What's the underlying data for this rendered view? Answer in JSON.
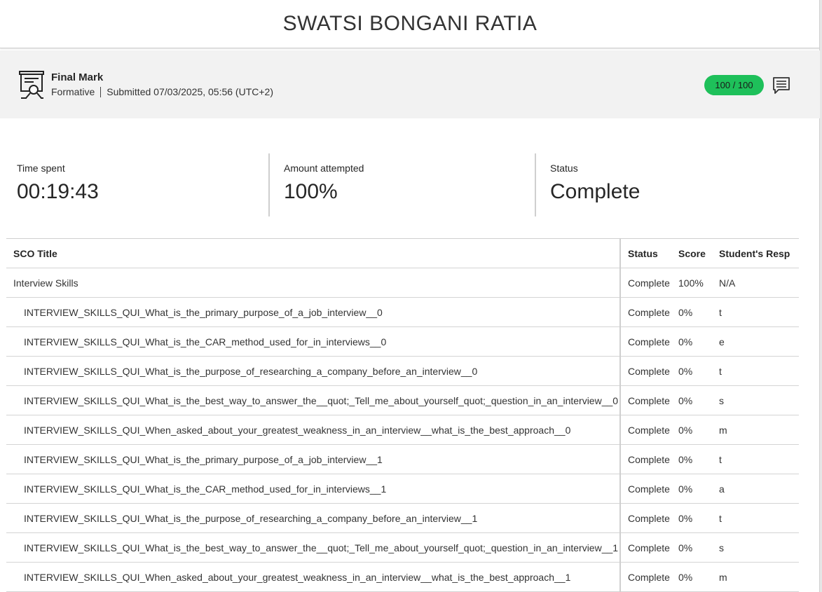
{
  "header": {
    "title": "SWATSI BONGANI RATIA"
  },
  "grade": {
    "title": "Final Mark",
    "type": "Formative",
    "submitted": "Submitted 07/03/2025, 05:56 (UTC+2)",
    "score": "100 / 100",
    "score_color": "#1ec05a",
    "icon": "certificate-icon",
    "feedback_icon": "feedback-comment-icon"
  },
  "stats": {
    "time_label": "Time spent",
    "time_value": "00:19:43",
    "attempted_label": "Amount attempted",
    "attempted_value": "100%",
    "status_label": "Status",
    "status_value": "Complete"
  },
  "table": {
    "headers": {
      "title": "SCO Title",
      "status": "Status",
      "score": "Score",
      "response": "Student's Resp"
    },
    "rows": [
      {
        "title": "Interview Skills",
        "status": "Complete",
        "score": "100%",
        "response": "N/A",
        "indent": false
      },
      {
        "title": "INTERVIEW_SKILLS_QUI_What_is_the_primary_purpose_of_a_job_interview__0",
        "status": "Complete",
        "score": "0%",
        "response": "t",
        "indent": true
      },
      {
        "title": "INTERVIEW_SKILLS_QUI_What_is_the_CAR_method_used_for_in_interviews__0",
        "status": "Complete",
        "score": "0%",
        "response": "e",
        "indent": true
      },
      {
        "title": "INTERVIEW_SKILLS_QUI_What_is_the_purpose_of_researching_a_company_before_an_interview__0",
        "status": "Complete",
        "score": "0%",
        "response": "t",
        "indent": true
      },
      {
        "title": "INTERVIEW_SKILLS_QUI_What_is_the_best_way_to_answer_the__quot;_Tell_me_about_yourself_quot;_question_in_an_interview__0",
        "status": "Complete",
        "score": "0%",
        "response": "s",
        "indent": true
      },
      {
        "title": "INTERVIEW_SKILLS_QUI_When_asked_about_your_greatest_weakness_in_an_interview__what_is_the_best_approach__0",
        "status": "Complete",
        "score": "0%",
        "response": "m",
        "indent": true
      },
      {
        "title": "INTERVIEW_SKILLS_QUI_What_is_the_primary_purpose_of_a_job_interview__1",
        "status": "Complete",
        "score": "0%",
        "response": "t",
        "indent": true
      },
      {
        "title": "INTERVIEW_SKILLS_QUI_What_is_the_CAR_method_used_for_in_interviews__1",
        "status": "Complete",
        "score": "0%",
        "response": "a",
        "indent": true
      },
      {
        "title": "INTERVIEW_SKILLS_QUI_What_is_the_purpose_of_researching_a_company_before_an_interview__1",
        "status": "Complete",
        "score": "0%",
        "response": "t",
        "indent": true
      },
      {
        "title": "INTERVIEW_SKILLS_QUI_What_is_the_best_way_to_answer_the__quot;_Tell_me_about_yourself_quot;_question_in_an_interview__1",
        "status": "Complete",
        "score": "0%",
        "response": "s",
        "indent": true
      },
      {
        "title": "INTERVIEW_SKILLS_QUI_When_asked_about_your_greatest_weakness_in_an_interview__what_is_the_best_approach__1",
        "status": "Complete",
        "score": "0%",
        "response": "m",
        "indent": true
      }
    ]
  }
}
